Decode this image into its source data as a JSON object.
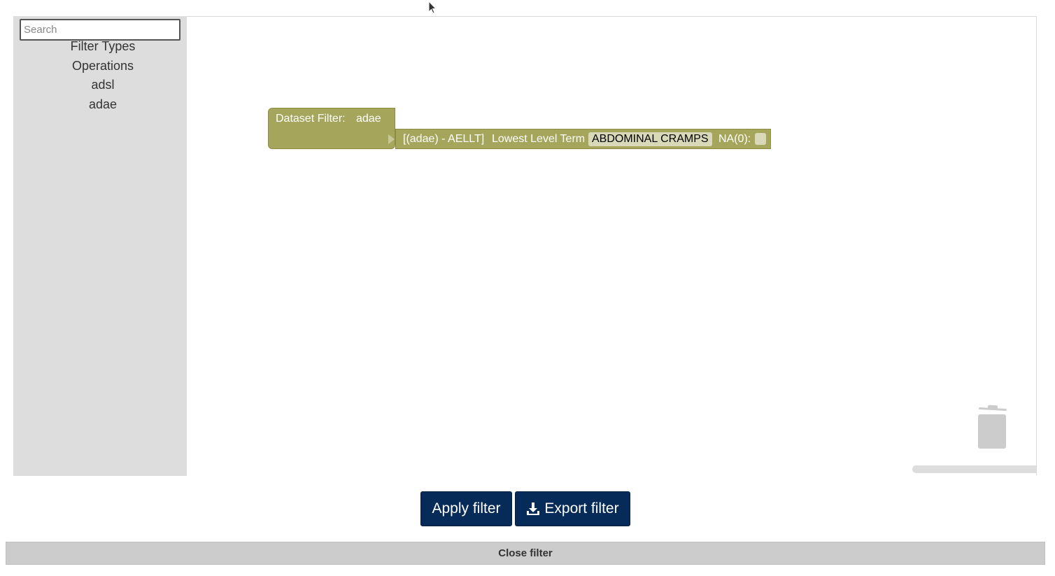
{
  "toolbox": {
    "search_placeholder": "Search",
    "categories": [
      "Filter Types",
      "Operations",
      "adsl",
      "adae"
    ]
  },
  "workspace": {
    "dataset_block": {
      "label": "Dataset Filter:",
      "dataset": "adae"
    },
    "filter_block": {
      "variable": "[(adae) - AELLT]",
      "name": "Lowest Level Term",
      "value": "ABDOMINAL CRAMPS",
      "na_label": "NA(0):",
      "na_checked": false
    },
    "block_color": "#a5a55b"
  },
  "actions": {
    "apply_label": "Apply filter",
    "export_label": "Export filter",
    "close_label": "Close filter",
    "button_color": "#062b58"
  },
  "icons": {
    "cursor": "pointer-cursor-icon",
    "trash": "trash-icon",
    "download": "download-icon"
  }
}
